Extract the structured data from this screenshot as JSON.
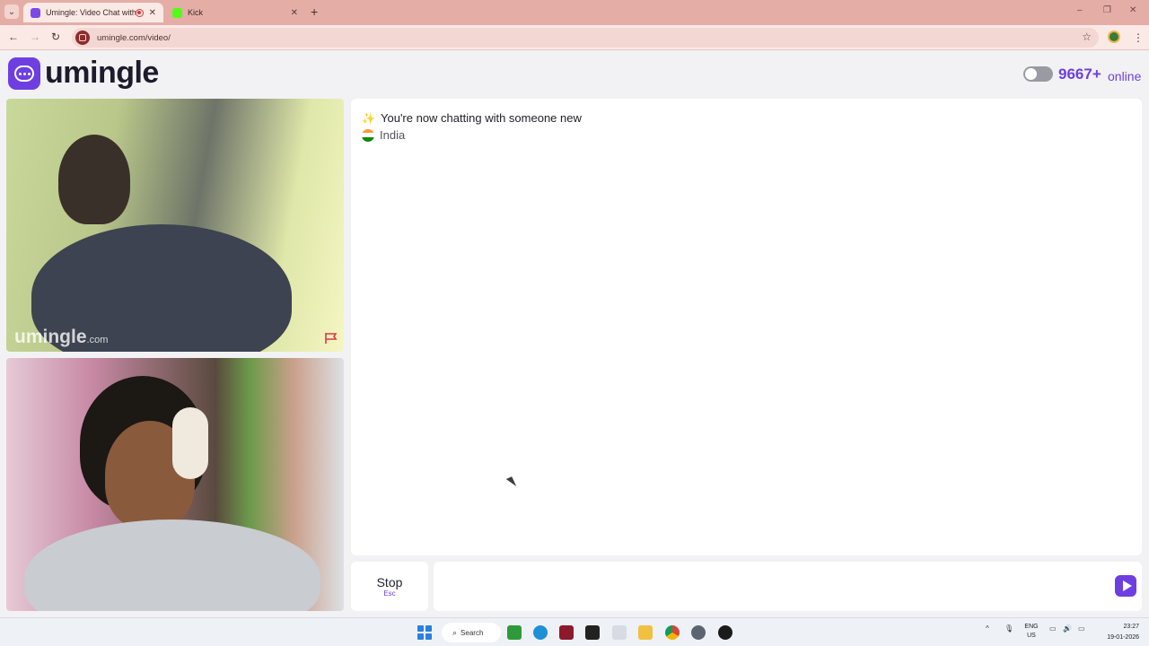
{
  "browser": {
    "tabs": [
      {
        "title": "Umingle: Video Chat with S",
        "active": true,
        "favicon_color": "#7a4ae6",
        "recording": true
      },
      {
        "title": "Kick",
        "active": false,
        "favicon_color": "#53fc18"
      }
    ],
    "new_tab_glyph": "+",
    "url": "umingle.com/video/",
    "window_controls": {
      "minimize": "–",
      "restore": "❐",
      "close": "✕"
    },
    "nav": {
      "back": "←",
      "forward": "→",
      "reload": "↻"
    },
    "bookmark_glyph": "☆",
    "menu_glyph": "⋮"
  },
  "header": {
    "logo_text": "umingle",
    "online_count": "9667+",
    "online_label": "online"
  },
  "videos": {
    "watermark_main": "umingle",
    "watermark_suffix": ".com"
  },
  "chat": {
    "status_emoji": "✨",
    "status_message": "You're now chatting with someone new",
    "country": "India"
  },
  "controls": {
    "stop_label": "Stop",
    "stop_key": "Esc",
    "message_placeholder": ""
  },
  "taskbar": {
    "search_label": "Search",
    "lang_line1": "ENG",
    "lang_line2": "US",
    "time": "23:27",
    "date": "19-01-2026"
  },
  "colors": {
    "brand": "#6d3fe0",
    "tab_strip": "#e4aea6"
  }
}
